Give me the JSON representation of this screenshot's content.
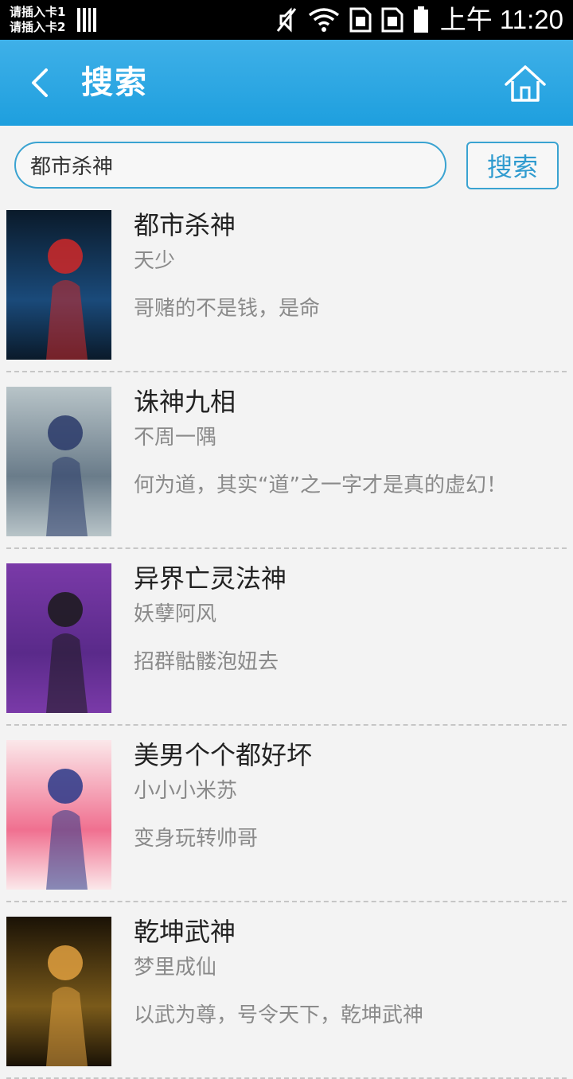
{
  "status_bar": {
    "sim1": "请插入卡1",
    "sim2": "请插入卡2",
    "time": "上午 11:20",
    "icons": [
      "signal-bars-icon",
      "mute-icon",
      "wifi-icon",
      "sim1-icon",
      "sim2-icon",
      "battery-icon"
    ]
  },
  "header": {
    "title": "搜索",
    "back_icon": "back-arrow-icon",
    "home_icon": "home-icon"
  },
  "search": {
    "value": "都市杀神",
    "button_label": "搜索"
  },
  "books": [
    {
      "title": "都市杀神",
      "author": "天少",
      "desc": "哥赌的不是钱，是命",
      "cover_colors": [
        "#0a1a2a",
        "#1a4a7a",
        "#d02828"
      ]
    },
    {
      "title": "诛神九相",
      "author": "不周一隅",
      "desc": "何为道，其实“道”之一字才是真的虚幻！",
      "cover_colors": [
        "#b8c4c8",
        "#6a7c8a",
        "#2a3a6a"
      ]
    },
    {
      "title": "异界亡灵法神",
      "author": "妖孽阿风",
      "desc": "招群骷髅泡妞去",
      "cover_colors": [
        "#7a3aa8",
        "#5a2a8a",
        "#1a1a1a"
      ]
    },
    {
      "title": "美男个个都好坏",
      "author": "小小小米苏",
      "desc": "变身玩转帅哥",
      "cover_colors": [
        "#fbe8ea",
        "#f07090",
        "#2a3a8a"
      ]
    },
    {
      "title": "乾坤武神",
      "author": "梦里成仙",
      "desc": "以武为尊，号令天下，乾坤武神",
      "cover_colors": [
        "#1a1206",
        "#7a5a1a",
        "#e0a040"
      ]
    }
  ],
  "colors": {
    "header_top": "#3fb0e8",
    "header_bottom": "#1e9fde",
    "accent": "#3aa3d1",
    "background": "#f3f3f3"
  }
}
